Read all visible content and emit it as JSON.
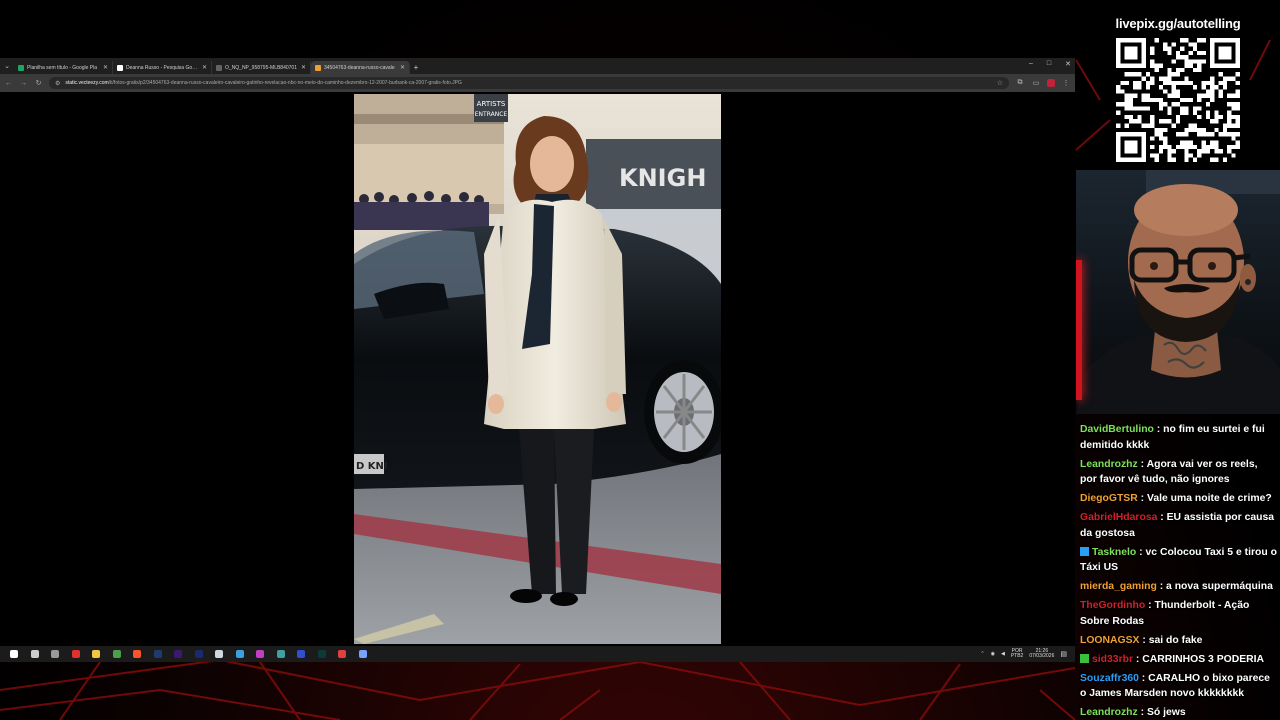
{
  "browser": {
    "tabs": [
      {
        "title": "Planilha sem título - Google Pla",
        "favicon_color": "#1fa463",
        "active": false
      },
      {
        "title": "Deanna Russo - Pesquisa Google",
        "favicon_color": "#ffffff",
        "active": false
      },
      {
        "title": "O_NQ_NP_958795-MLB840701",
        "favicon_color": "#5f6368",
        "active": false
      },
      {
        "title": "34504763-deanna-russo-cavale",
        "favicon_color": "#f0a030",
        "active": true
      }
    ],
    "new_tab": "+",
    "window_controls": [
      "–",
      "□",
      "✕"
    ],
    "address": {
      "host": "static.vecteezy.com",
      "path": "/ti/fotos-gratis/p2/34504763-deanna-russo-cavaleiro-cavaleiro-gatinho-revelacao-nbc-no-meio-do-caminho-dezembro-12-2007-burbank-ca-2007-gratis-foto.JPG"
    }
  },
  "photo": {
    "sign_artists": "ARTISTS",
    "sign_entrance": "ENTRANCE",
    "banner_text": "KNIGH",
    "plate_text": "D KNI"
  },
  "taskbar": {
    "apps": [
      {
        "name": "windows-start",
        "color": "#ffffff"
      },
      {
        "name": "task-view",
        "color": "#cccccc"
      },
      {
        "name": "app-3",
        "color": "#9a9a9a"
      },
      {
        "name": "app-4",
        "color": "#e03030"
      },
      {
        "name": "file-explorer",
        "color": "#f3c640"
      },
      {
        "name": "chrome",
        "color": "#4aa04a"
      },
      {
        "name": "brave",
        "color": "#fb542b"
      },
      {
        "name": "photoshop",
        "color": "#1e3a6e"
      },
      {
        "name": "premiere",
        "color": "#3a1a6e"
      },
      {
        "name": "media-encoder",
        "color": "#1a2a6e"
      },
      {
        "name": "notepad",
        "color": "#cfd8e0"
      },
      {
        "name": "app-12",
        "color": "#3aa0e0"
      },
      {
        "name": "app-13",
        "color": "#c040c0"
      },
      {
        "name": "app-14",
        "color": "#40a0a0"
      },
      {
        "name": "app-15",
        "color": "#3050d0"
      },
      {
        "name": "audition",
        "color": "#0a3a3a"
      },
      {
        "name": "app-17",
        "color": "#e04040"
      },
      {
        "name": "app-18",
        "color": "#7aa0ff"
      }
    ],
    "lang": "POR",
    "lang_sub": "PTB2",
    "time": "21:26",
    "date": "07/03/2026"
  },
  "stream": {
    "livepix": "livepix.gg/autotelling"
  },
  "chat": [
    {
      "user": "DavidBertulino",
      "color": "#7fe05a",
      "text": "no fim eu surtei e fui demitido kkkk"
    },
    {
      "user": "Leandrozhz",
      "color": "#7fe05a",
      "text": "Agora vai ver os reels, por favor vê tudo, não ignores"
    },
    {
      "user": "DiegoGTSR",
      "color": "#f0a030",
      "text": "Vale uma noite de crime?"
    },
    {
      "user": "GabrielHdarosa",
      "color": "#d0202a",
      "text": "EU assistia por causa da gostosa"
    },
    {
      "user": "Tasknelo",
      "color": "#7fe05a",
      "text": "vc Colocou Taxi 5 e tirou o Táxi US",
      "badge": "#2a9df4"
    },
    {
      "user": "mierda_gaming",
      "color": "#f0a030",
      "text": "a nova supermáquina"
    },
    {
      "user": "TheGordinho",
      "color": "#d0202a",
      "text": "Thunderbolt - Ação Sobre Rodas"
    },
    {
      "user": "LOONAGSX",
      "color": "#f0a030",
      "text": "sai do fake"
    },
    {
      "user": "sid33rbr",
      "color": "#d0202a",
      "text": "CARRINHOS 3 PODERIA",
      "badge": "#3ac03a"
    },
    {
      "user": "Souzaffr360",
      "color": "#2a9df4",
      "text": "CARALHO o bixo parece o James Marsden novo kkkkkkkk"
    },
    {
      "user": "Leandrozhz",
      "color": "#7fe05a",
      "text": "Só jews"
    }
  ]
}
